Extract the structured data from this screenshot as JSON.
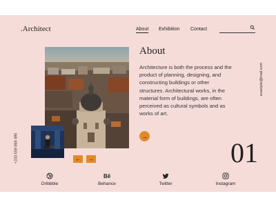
{
  "header": {
    "logo": ".Architect",
    "nav": {
      "about": "About",
      "exhibition": "Exhibition",
      "contact": "Contact"
    }
  },
  "about": {
    "title": "About",
    "text": "Architecture is both the process and the product of planning, designing, and constructing buildings or other structures. Architectural works, in the material form of buildings, are often perceived as cultural symbols and as works of art."
  },
  "slide_number": "01",
  "contact": {
    "email": "example@mail.com",
    "phone": "+233 559 068 490"
  },
  "social": [
    {
      "label": "Dribbble",
      "icon": "dribbble-icon"
    },
    {
      "label": "Behance",
      "icon": "behance-icon"
    },
    {
      "label": "Twitter",
      "icon": "twitter-icon"
    },
    {
      "label": "Instagram",
      "icon": "instagram-icon"
    }
  ],
  "colors": {
    "background": "#f6dcd9",
    "accent": "#e28a2a"
  }
}
